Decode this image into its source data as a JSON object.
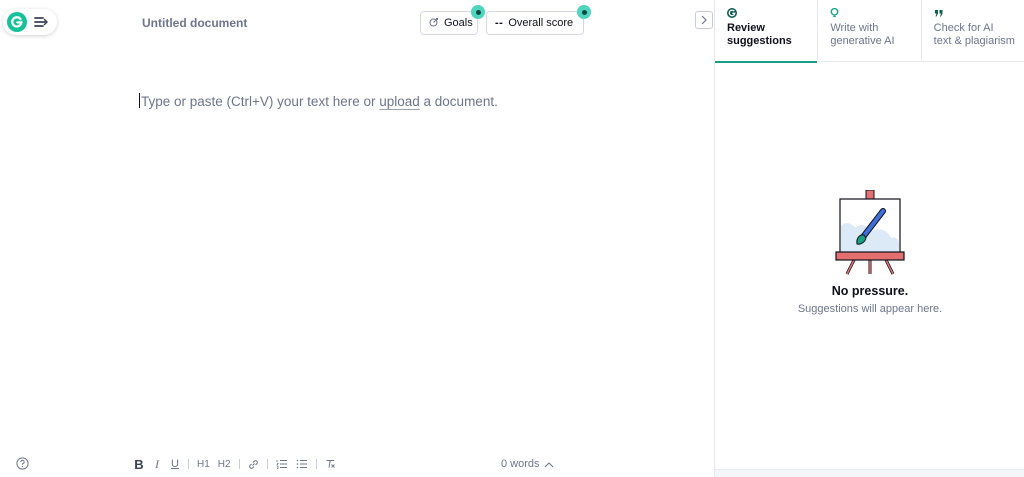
{
  "header": {
    "doc_title": "Untitled document",
    "goals_label": "Goals",
    "score_prefix": "--",
    "score_label": "Overall score"
  },
  "editor": {
    "placeholder_before": "Type or paste (Ctrl+V) your text here or ",
    "placeholder_link": "upload",
    "placeholder_after": " a document."
  },
  "toolbar": {
    "bold": "B",
    "italic": "I",
    "underline": "U",
    "h1": "H1",
    "h2": "H2",
    "word_count": "0 words"
  },
  "panel": {
    "tabs": [
      {
        "label_line1": "Review",
        "label_line2": "suggestions",
        "icon": "grammarly-g-icon",
        "active": true
      },
      {
        "label_line1": "Write with",
        "label_line2": "generative AI",
        "icon": "lightbulb-icon",
        "active": false
      },
      {
        "label_line1": "Check for AI",
        "label_line2": "text & plagiarism",
        "icon": "quote-icon",
        "active": false
      }
    ],
    "empty_title": "No pressure.",
    "empty_subtitle": "Suggestions will appear here."
  },
  "colors": {
    "brand": "#15c39a",
    "accent_dot": "#4fd4bd",
    "active_tab_underline": "#15a383",
    "muted_text": "#6d758d"
  }
}
